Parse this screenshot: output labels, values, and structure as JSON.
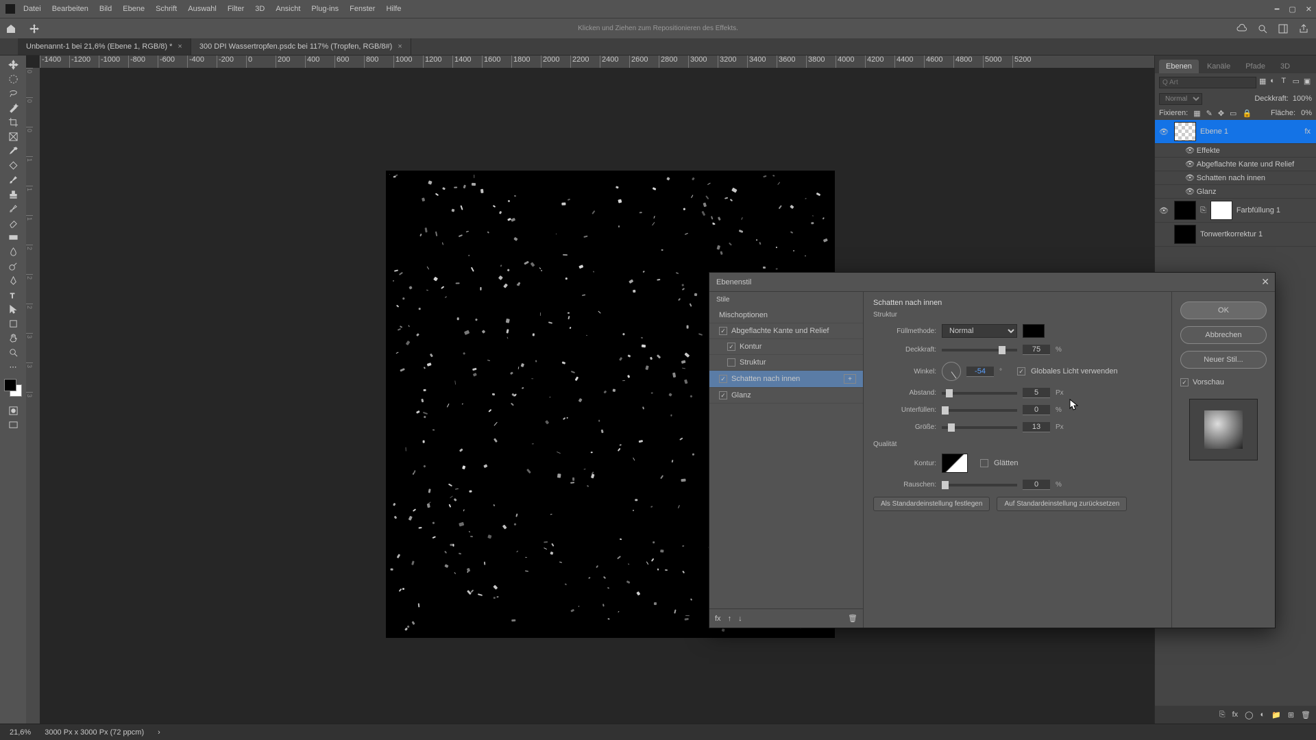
{
  "menu": {
    "items": [
      "Datei",
      "Bearbeiten",
      "Bild",
      "Ebene",
      "Schrift",
      "Auswahl",
      "Filter",
      "3D",
      "Ansicht",
      "Plug-ins",
      "Fenster",
      "Hilfe"
    ]
  },
  "optbar": {
    "hint": "Klicken und Ziehen zum Repositionieren des Effekts."
  },
  "tabs": [
    {
      "label": "Unbenannt-1 bei 21,6% (Ebene 1, RGB/8) *",
      "active": true
    },
    {
      "label": "300 DPI Wassertropfen.psdc bei 117% (Tropfen, RGB/8#)",
      "active": false
    }
  ],
  "ruler_marks": [
    "-1400",
    "-1200",
    "-1000",
    "-800",
    "-600",
    "-400",
    "-200",
    "0",
    "200",
    "400",
    "600",
    "800",
    "1000",
    "1200",
    "1400",
    "1600",
    "1800",
    "2000",
    "2200",
    "2400",
    "2600",
    "2800",
    "3000",
    "3200",
    "3400",
    "3600",
    "3800",
    "4000",
    "4200",
    "4400",
    "4600",
    "4800",
    "5000",
    "5200"
  ],
  "ruler_v": [
    "0",
    "0",
    "0",
    "1",
    "1",
    "1",
    "2",
    "2",
    "2",
    "3",
    "3",
    "3"
  ],
  "panels": {
    "tabs": [
      "Ebenen",
      "Kanäle",
      "Pfade",
      "3D"
    ],
    "filter_ph": "Q Art",
    "blend": "Normal",
    "opacity_label": "Deckkraft:",
    "opacity_val": "100%",
    "lock_label": "Fixieren:",
    "fill_label": "Fläche:",
    "fill_val": "0%",
    "layers": [
      {
        "name": "Ebene 1",
        "eye": true,
        "active": true,
        "fx": true
      },
      {
        "name": "Effekte",
        "sub": true
      },
      {
        "name": "Abgeflachte Kante und Relief",
        "sub": true
      },
      {
        "name": "Schatten nach innen",
        "sub": true
      },
      {
        "name": "Glanz",
        "sub": true
      },
      {
        "name": "Farbfüllung 1",
        "eye": true
      },
      {
        "name": "Tonwertkorrektur 1"
      }
    ]
  },
  "status": {
    "zoom": "21,6%",
    "dims": "3000 Px x 3000 Px (72 ppcm)"
  },
  "modal": {
    "title": "Ebenenstil",
    "left_header": "Stile",
    "left_sub": "Mischoptionen",
    "styles": [
      {
        "label": "Abgeflachte Kante und Relief",
        "checked": true,
        "indent": false
      },
      {
        "label": "Kontur",
        "checked": true,
        "indent": true
      },
      {
        "label": "Struktur",
        "checked": false,
        "indent": true
      },
      {
        "label": "Schatten nach innen",
        "checked": true,
        "indent": false,
        "selected": true,
        "plus": true
      },
      {
        "label": "Glanz",
        "checked": true,
        "indent": false
      }
    ],
    "section": {
      "title": "Schatten nach innen",
      "struct": "Struktur",
      "blend_label": "Füllmethode:",
      "blend_value": "Normal",
      "opacity_label": "Deckkraft:",
      "opacity_value": "75",
      "opacity_unit": "%",
      "angle_label": "Winkel:",
      "angle_value": "-54",
      "angle_unit": "°",
      "global_light": "Globales Licht verwenden",
      "distance_label": "Abstand:",
      "distance_value": "5",
      "distance_unit": "Px",
      "choke_label": "Unterfüllen:",
      "choke_value": "0",
      "choke_unit": "%",
      "size_label": "Größe:",
      "size_value": "13",
      "size_unit": "Px",
      "quality": "Qualität",
      "contour_label": "Kontur:",
      "aa_label": "Glätten",
      "noise_label": "Rauschen:",
      "noise_value": "0",
      "noise_unit": "%",
      "make_default": "Als Standardeinstellung festlegen",
      "reset_default": "Auf Standardeinstellung zurücksetzen"
    },
    "right": {
      "ok": "OK",
      "cancel": "Abbrechen",
      "newstyle": "Neuer Stil...",
      "preview": "Vorschau"
    }
  }
}
